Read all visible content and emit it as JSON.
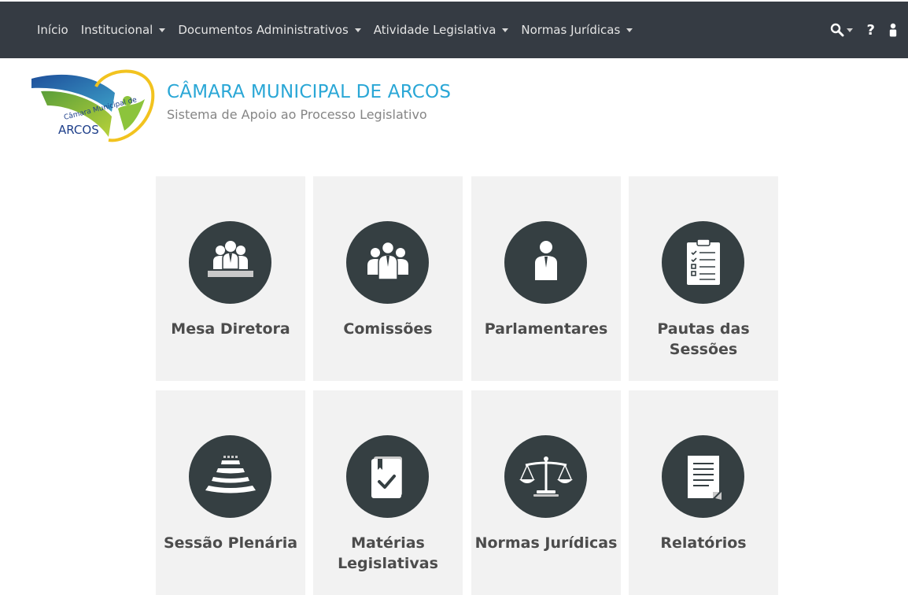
{
  "nav": {
    "items": [
      {
        "label": "Início"
      },
      {
        "label": "Institucional"
      },
      {
        "label": "Documentos Administrativos"
      },
      {
        "label": "Atividade Legislativa"
      },
      {
        "label": "Normas Jurídicas"
      }
    ],
    "help_label": "?",
    "icons": [
      "search-icon",
      "help-icon",
      "user-icon"
    ]
  },
  "header": {
    "title": "CÂMARA MUNICIPAL DE ARCOS",
    "subtitle": "Sistema de Apoio ao Processo Legislativo",
    "logo": {
      "arc_text": "Câmara Municipal de",
      "town": "ARCOS"
    }
  },
  "cards": [
    {
      "label": "Mesa Diretora",
      "icon": "board-table-icon"
    },
    {
      "label": "Comissões",
      "icon": "group-icon"
    },
    {
      "label": "Parlamentares",
      "icon": "person-icon"
    },
    {
      "label": "Pautas das Sessões",
      "icon": "clipboard-checklist-icon"
    },
    {
      "label": "Sessão Plenária",
      "icon": "plenary-icon"
    },
    {
      "label": "Matérias Legislativas",
      "icon": "book-check-icon"
    },
    {
      "label": "Normas Jurídicas",
      "icon": "scales-icon"
    },
    {
      "label": "Relatórios",
      "icon": "report-document-icon"
    }
  ],
  "colors": {
    "navbar": "#353b43",
    "accent": "#2aa7d6",
    "card_bg": "#f2f2f2",
    "icon_circle": "#353f42"
  }
}
